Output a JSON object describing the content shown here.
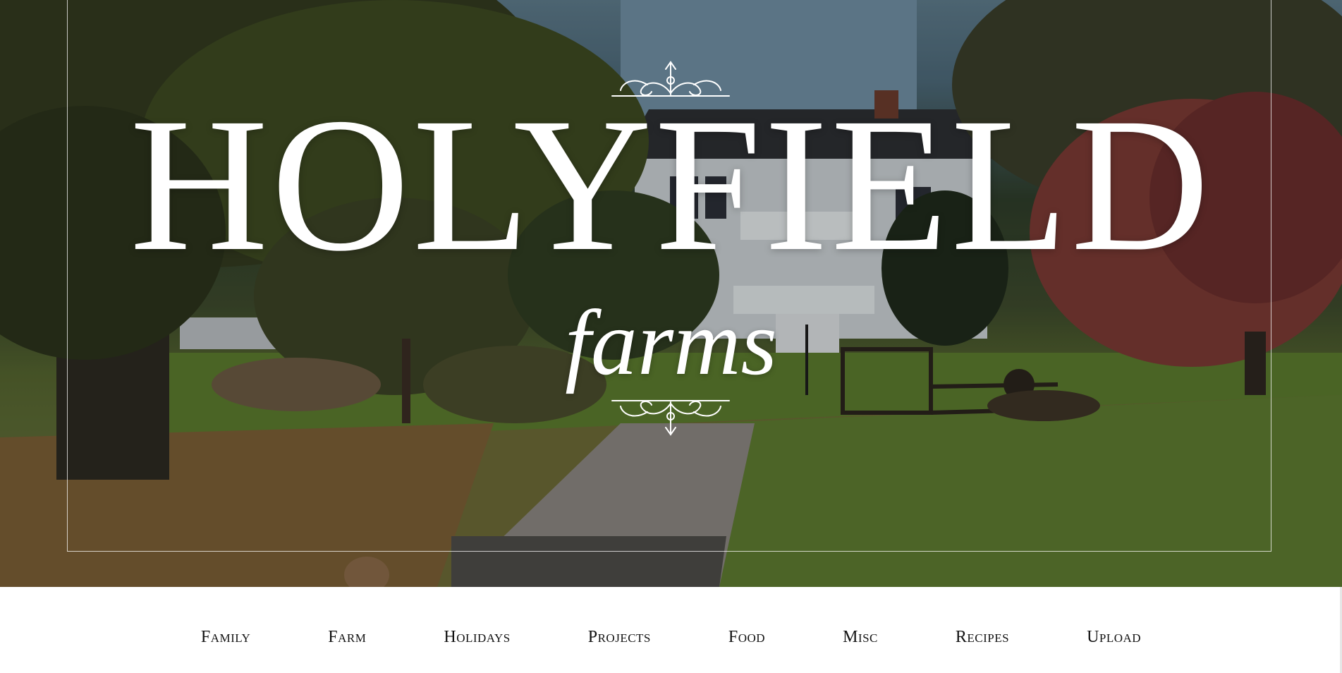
{
  "hero": {
    "title": "HOLYFIELD",
    "subtitle": "farms",
    "ornament_top_icon": "flourish-ornament-icon",
    "ornament_bottom_icon": "flourish-ornament-icon"
  },
  "nav": {
    "items": [
      {
        "label": "Family"
      },
      {
        "label": "Farm"
      },
      {
        "label": "Holidays"
      },
      {
        "label": "Projects"
      },
      {
        "label": "Food"
      },
      {
        "label": "Misc"
      },
      {
        "label": "Recipes"
      },
      {
        "label": "Upload"
      }
    ]
  },
  "colors": {
    "title": "#ffffff",
    "nav_text": "#111111",
    "nav_background": "#ffffff"
  }
}
